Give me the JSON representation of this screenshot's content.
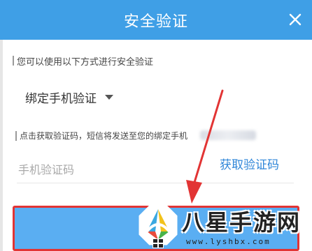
{
  "dialog": {
    "title": "安全验证",
    "hint": "您可以使用以下方式进行安全验证",
    "method": {
      "selected": "绑定手机验证"
    },
    "sms_hint": "点击获取验证码，短信将发送至您的绑定手机",
    "code_input": {
      "placeholder": "手机验证码",
      "value": ""
    },
    "get_code_label": "获取验证码"
  },
  "watermark": {
    "brand": "八星手游网",
    "url": "www.lyshbx.com"
  },
  "colors": {
    "titlebar": "#3f9fe6",
    "link": "#2f86d8",
    "submit_button": "#5aaef2",
    "annotation": "#e23434"
  },
  "icons": {
    "close": "close-icon",
    "dropdown": "caret-down-icon",
    "logo": "octagon-logo"
  }
}
